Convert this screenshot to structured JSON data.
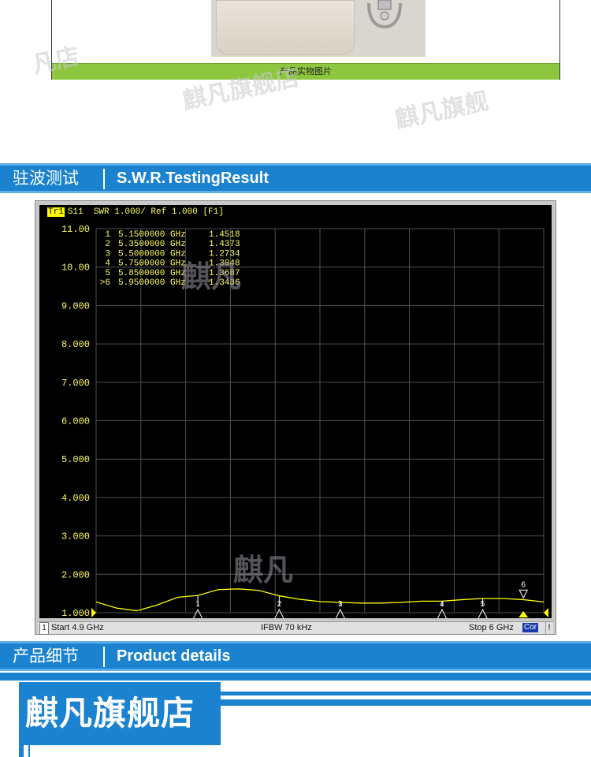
{
  "photo": {
    "caption": "产品实物图片"
  },
  "watermark": {
    "store_fragment": "凡店",
    "store_short": "麒凡旗舰店",
    "store_tail": "麒凡旗舰",
    "brand": "麒凡"
  },
  "section_swr": {
    "title_cn": "驻波测试",
    "title_en": "S.W.R.TestingResult"
  },
  "analyzer": {
    "trace_tag": "Tr1",
    "trace_header": "S11  SWR 1.000/ Ref 1.000 [F1]",
    "y_ticks": [
      "11.00",
      "10.00",
      "9.000",
      "8.000",
      "7.000",
      "6.000",
      "5.000",
      "4.000",
      "3.000",
      "2.000",
      "1.000"
    ],
    "markers": [
      {
        "id": "1",
        "freq": "5.1500000 GHz",
        "swr": "1.4518"
      },
      {
        "id": "2",
        "freq": "5.3500000 GHz",
        "swr": "1.4373"
      },
      {
        "id": "3",
        "freq": "5.5000000 GHz",
        "swr": "1.2734"
      },
      {
        "id": "4",
        "freq": "5.7500000 GHz",
        "swr": "1.3048"
      },
      {
        "id": "5",
        "freq": "5.8500000 GHz",
        "swr": "1.3687"
      },
      {
        "id": ">6",
        "freq": "5.9500000 GHz",
        "swr": "1.3436"
      }
    ],
    "status": {
      "channel": "1",
      "start": "Start 4.9 GHz",
      "ifbw": "IFBW 70 kHz",
      "stop": "Stop 6 GHz",
      "cor": "Cor",
      "excl": "!"
    },
    "colors": {
      "trace": "#ffff00",
      "grid": "#505050",
      "screen": "#000000"
    }
  },
  "chart_data": {
    "type": "line",
    "title": "S11 SWR 1.000/ Ref 1.000 [F1]",
    "xlabel": "",
    "ylabel": "",
    "xlim": [
      4.9,
      6.0
    ],
    "ylim": [
      1.0,
      11.0
    ],
    "y_tick_step": 1.0,
    "grid": true,
    "series": [
      {
        "x": [
          4.9,
          4.95,
          5.0,
          5.05,
          5.1,
          5.15,
          5.2,
          5.25,
          5.3,
          5.35,
          5.4,
          5.45,
          5.5,
          5.55,
          5.6,
          5.65,
          5.7,
          5.75,
          5.8,
          5.85,
          5.9,
          5.95,
          6.0
        ],
        "y": [
          1.28,
          1.12,
          1.05,
          1.2,
          1.4,
          1.45,
          1.6,
          1.62,
          1.58,
          1.44,
          1.35,
          1.29,
          1.27,
          1.25,
          1.25,
          1.27,
          1.3,
          1.3,
          1.34,
          1.37,
          1.37,
          1.34,
          1.28
        ]
      }
    ],
    "markers": [
      {
        "label": "1",
        "x": 5.15,
        "y": 1.4518
      },
      {
        "label": "2",
        "x": 5.35,
        "y": 1.4373
      },
      {
        "label": "3",
        "x": 5.5,
        "y": 1.2734
      },
      {
        "label": "4",
        "x": 5.75,
        "y": 1.3048
      },
      {
        "label": "5",
        "x": 5.85,
        "y": 1.3687
      },
      {
        "label": "6",
        "x": 5.95,
        "y": 1.3436
      }
    ]
  },
  "section_details": {
    "title_cn": "产品细节",
    "title_en": "Product details"
  },
  "banner": {
    "title": "麒凡旗舰店"
  }
}
